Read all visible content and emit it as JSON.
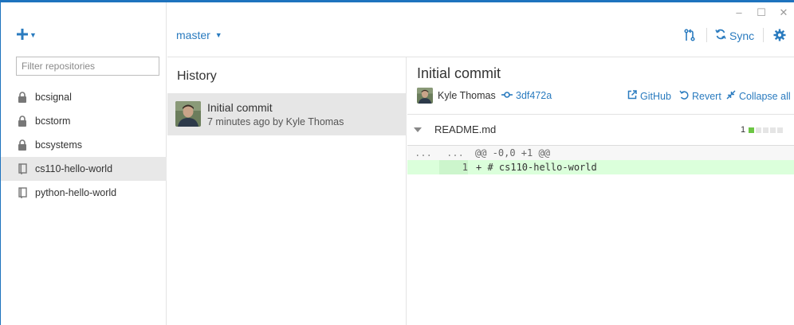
{
  "window": {
    "controls": [
      "–",
      "☐",
      "✕"
    ]
  },
  "sidebar": {
    "filter_placeholder": "Filter repositories",
    "repos": [
      {
        "label": "bcsignal",
        "icon": "lock-icon",
        "selected": false
      },
      {
        "label": "bcstorm",
        "icon": "lock-icon",
        "selected": false
      },
      {
        "label": "bcsystems",
        "icon": "lock-icon",
        "selected": false
      },
      {
        "label": "cs110-hello-world",
        "icon": "repo-icon",
        "selected": true
      },
      {
        "label": "python-hello-world",
        "icon": "repo-icon",
        "selected": false
      }
    ]
  },
  "header": {
    "branch": "master",
    "sync_label": "Sync"
  },
  "history": {
    "title": "History",
    "commits": [
      {
        "title": "Initial commit",
        "subtitle": "7 minutes ago by Kyle Thomas"
      }
    ]
  },
  "detail": {
    "title": "Initial commit",
    "author": "Kyle Thomas",
    "sha": "3df472a",
    "actions": {
      "github": "GitHub",
      "revert": "Revert",
      "collapse": "Collapse all"
    },
    "file": {
      "name": "README.md",
      "additions": "1"
    },
    "diff": {
      "hunk_left": "...",
      "hunk_right": "...",
      "hunk_text": "@@ -0,0 +1 @@",
      "line_number": "1",
      "line_text": "+ # cs110-hello-world"
    }
  },
  "colors": {
    "accent": "#2a7bbf",
    "addition": "#6cc644"
  }
}
